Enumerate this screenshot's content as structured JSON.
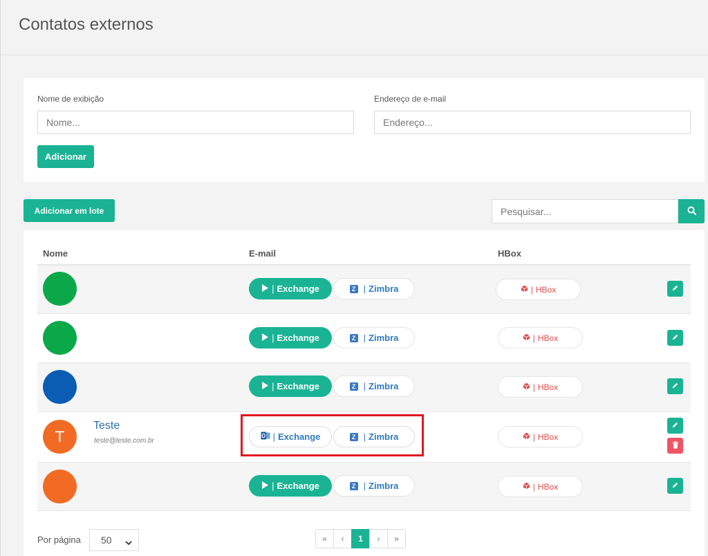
{
  "page": {
    "title": "Contatos externos"
  },
  "form": {
    "display_name_label": "Nome de exibição",
    "display_name_placeholder": "Nome...",
    "email_label": "Endereço de e-mail",
    "email_placeholder": "Endereço...",
    "add_label": "Adicionar"
  },
  "toolbar": {
    "bulk_add_label": "Adicionar em lote",
    "search_placeholder": "Pesquisar..."
  },
  "table": {
    "headers": {
      "name": "Nome",
      "email": "E-mail",
      "hbox": "HBox"
    },
    "exchange_label": "Exchange",
    "zimbra_label": "Zimbra",
    "hbox_label": "HBox",
    "separator": "|",
    "rows": [
      {
        "avatar_color": "#0ba84a",
        "avatar_letter": "",
        "name": "",
        "email": "",
        "exchange_style": "green"
      },
      {
        "avatar_color": "#0ba84a",
        "avatar_letter": "",
        "name": "",
        "email": "",
        "exchange_style": "green"
      },
      {
        "avatar_color": "#0a5db3",
        "avatar_letter": "",
        "name": "",
        "email": "",
        "exchange_style": "green"
      },
      {
        "avatar_color": "#f26b24",
        "avatar_letter": "T",
        "name": "Teste",
        "email": "teste@teste.com.br",
        "exchange_style": "outlook-outline"
      },
      {
        "avatar_color": "#f26b24",
        "avatar_letter": "",
        "name": "",
        "email": "",
        "exchange_style": "green"
      }
    ]
  },
  "pagination": {
    "per_page_label": "Por página",
    "per_page_value": "50",
    "first": "«",
    "prev": "‹",
    "current": "1",
    "next": "›",
    "last": "»"
  },
  "colors": {
    "accent": "#1ab394",
    "danger": "#ed5565",
    "link": "#2a6dad",
    "highlight": "#e0171f"
  }
}
